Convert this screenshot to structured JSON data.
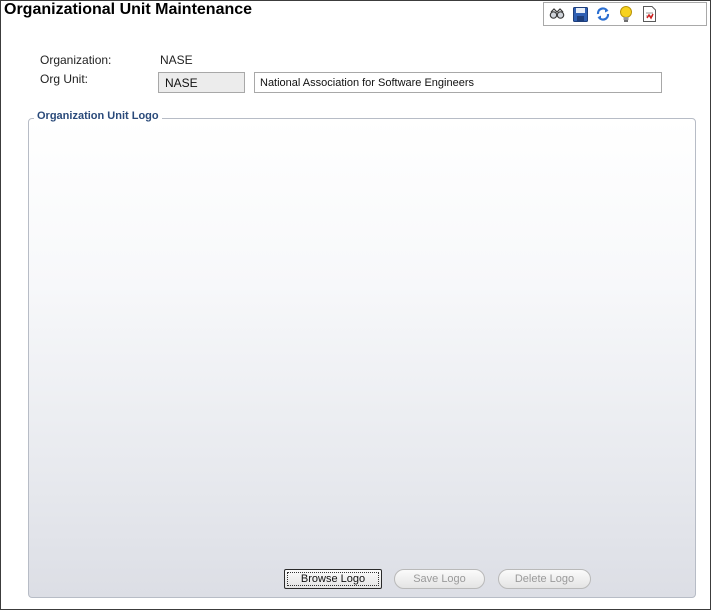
{
  "header": {
    "title": "Organizational Unit Maintenance"
  },
  "toolbar": {
    "buttons": [
      {
        "icon": "find-icon"
      },
      {
        "icon": "save-icon"
      },
      {
        "icon": "refresh-icon"
      },
      {
        "icon": "lightbulb-icon"
      },
      {
        "icon": "report-icon"
      }
    ]
  },
  "form": {
    "organization_label": "Organization:",
    "organization_value": "NASE",
    "org_unit_label": "Org Unit:",
    "org_unit_code": "NASE",
    "org_unit_name": "National Association for Software Engineers"
  },
  "logo_group": {
    "legend": "Organization Unit Logo",
    "browse_label": "Browse Logo",
    "save_label": "Save Logo",
    "delete_label": "Delete Logo"
  },
  "colors": {
    "legend_text": "#2a4a7a",
    "disabled_text": "#9a9a9a"
  }
}
